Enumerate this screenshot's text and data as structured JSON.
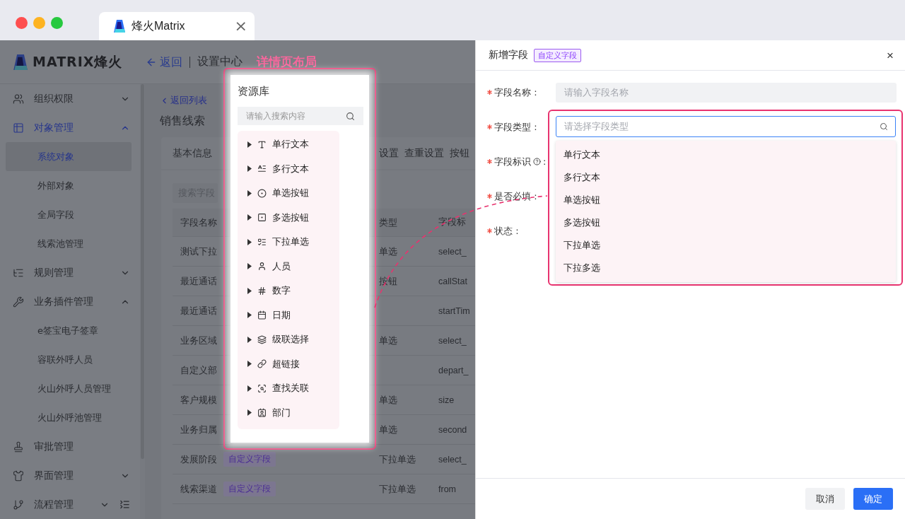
{
  "browser": {
    "tab": {
      "title": "烽火Matrix",
      "close": "×"
    }
  },
  "header": {
    "logo_text": "MATRIX烽火",
    "back": "返回",
    "breadcrumb": "设置中心",
    "annotation": "详情页布局"
  },
  "sidebar": {
    "groups": [
      {
        "label": "组织权限",
        "selected": false,
        "expanded": false
      },
      {
        "label": "对象管理",
        "selected": true,
        "expanded": true,
        "children": [
          {
            "label": "系统对象",
            "selected": true
          },
          {
            "label": "外部对象",
            "selected": false
          },
          {
            "label": "全局字段",
            "selected": false
          },
          {
            "label": "线索池管理",
            "selected": false
          }
        ]
      },
      {
        "label": "规则管理",
        "selected": false,
        "expanded": false
      },
      {
        "label": "业务插件管理",
        "selected": false,
        "expanded": true,
        "children": [
          {
            "label": "e签宝电子签章",
            "selected": false
          },
          {
            "label": "容联外呼人员",
            "selected": false
          },
          {
            "label": "火山外呼人员管理",
            "selected": false
          },
          {
            "label": "火山外呼池管理",
            "selected": false
          }
        ]
      },
      {
        "label": "审批管理",
        "selected": false
      },
      {
        "label": "界面管理",
        "selected": false,
        "expanded": false
      },
      {
        "label": "流程管理",
        "selected": false,
        "expanded": false
      }
    ]
  },
  "content": {
    "back_link": "返回列表",
    "title": "销售线索",
    "tabs": [
      "基本信息",
      "设置",
      "查重设置",
      "按钮"
    ],
    "search": {
      "placeholder": "搜索字段"
    },
    "table": {
      "columns": [
        "字段名称",
        "类型",
        "字段标"
      ],
      "rows": [
        {
          "name": "测试下拉",
          "type": "单选",
          "key": "select_"
        },
        {
          "name": "最近通话",
          "type": "按钮",
          "key": "callStat"
        },
        {
          "name": "最近通话",
          "key": "startTim"
        },
        {
          "name": "业务区域",
          "type": "单选",
          "key": "select_"
        },
        {
          "name": "自定义部",
          "key": "depart_"
        },
        {
          "name": "客户规模",
          "type": "单选",
          "key": "size"
        },
        {
          "name": "业务归属",
          "type": "单选",
          "key": "second"
        },
        {
          "name": "发展阶段",
          "tag": "自定义字段",
          "type": "下拉单选",
          "key": "select_"
        },
        {
          "name": "线索渠道",
          "tag": "自定义字段",
          "type": "下拉单选",
          "key": "from"
        }
      ]
    }
  },
  "resource_panel": {
    "title": "资源库",
    "search": {
      "placeholder": "请输入搜索内容"
    },
    "items": [
      {
        "label": "单行文本",
        "expanded": false
      },
      {
        "label": "多行文本",
        "expanded": false
      },
      {
        "label": "单选按钮",
        "expanded": false
      },
      {
        "label": "多选按钮",
        "expanded": false
      },
      {
        "label": "下拉单选",
        "expanded": false
      },
      {
        "label": "人员",
        "expanded": false
      },
      {
        "label": "数字",
        "expanded": false
      },
      {
        "label": "日期",
        "expanded": false
      },
      {
        "label": "级联选择",
        "expanded": false
      },
      {
        "label": "超链接",
        "expanded": false
      },
      {
        "label": "查找关联",
        "expanded": false
      },
      {
        "label": "部门",
        "expanded": false
      }
    ]
  },
  "drawer": {
    "title": "新增字段",
    "tag": "自定义字段",
    "close": "×",
    "fields": [
      {
        "label": "字段名称 :",
        "required": true,
        "kind": "input",
        "placeholder": "请输入字段名称"
      },
      {
        "label": "字段类型 :",
        "required": true,
        "kind": "select",
        "placeholder": "请选择字段类型",
        "focused": true,
        "options": [
          "单行文本",
          "多行文本",
          "单选按钮",
          "多选按钮",
          "下拉单选",
          "下拉多选"
        ]
      },
      {
        "label": "字段标识",
        "required": true,
        "kind": "label",
        "help": true,
        "suffix": ":"
      },
      {
        "label": "是否必填 :",
        "required": true,
        "kind": "label"
      },
      {
        "label": "状态 :",
        "required": true,
        "kind": "label"
      }
    ],
    "buttons": [
      {
        "label": "取消",
        "kind": "secondary"
      },
      {
        "label": "确定",
        "kind": "primary"
      }
    ]
  }
}
